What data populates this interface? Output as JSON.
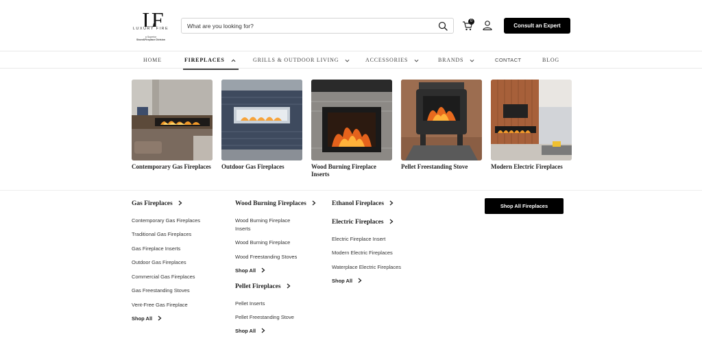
{
  "brand": {
    "logo_mark": "LF",
    "logo_name": "LUXURY FIRE",
    "logo_sub1": "a Superior",
    "logo_sub2": "Stove&Fireplace Division"
  },
  "search": {
    "placeholder": "What are you looking for?"
  },
  "cart": {
    "count": "0"
  },
  "header": {
    "consult_label": "Consult an Expert"
  },
  "nav": {
    "home": "HOME",
    "fireplaces": "FIREPLACES",
    "grills": "GRILLS & OUTDOOR LIVING",
    "accessories": "ACCESSORIES",
    "brands": "BRANDS",
    "contact": "CONTACT",
    "blog": "BLOG"
  },
  "categories": [
    {
      "label": "Contemporary Gas Fireplaces"
    },
    {
      "label": "Outdoor Gas Fireplaces"
    },
    {
      "label": "Wood Burning Fireplace Inserts"
    },
    {
      "label": "Pellet Freestanding Stove"
    },
    {
      "label": "Modern Electric Fireplaces"
    }
  ],
  "gas": {
    "heading": "Gas Fireplaces",
    "links": [
      "Contemporary Gas Fireplaces",
      "Traditional Gas Fireplaces",
      "Gas Fireplace Inserts",
      "Outdoor Gas Fireplaces",
      "Commercial Gas Fireplaces",
      "Gas Freestanding Stoves",
      "Vent-Free Gas Fireplace"
    ],
    "shop_all": "Shop All"
  },
  "wood": {
    "heading": "Wood Burning Fireplaces",
    "links": [
      "Wood Burning Fireplace Inserts",
      "Wood Burning Fireplace",
      "Wood Freestanding Stoves"
    ],
    "shop_all": "Shop All"
  },
  "pellet": {
    "heading": "Pellet Fireplaces",
    "links": [
      "Pellet Inserts",
      "Pellet Freestanding Stove"
    ],
    "shop_all": "Shop All"
  },
  "ethanol": {
    "heading": "Ethanol Fireplaces"
  },
  "electric": {
    "heading": "Electric Fireplaces",
    "links": [
      "Electric Fireplace Insert",
      "Modern Electric Fireplaces",
      "Waterplace Electric Fireplaces"
    ],
    "shop_all": "Shop All"
  },
  "shop_all_button": "Shop All Fireplaces"
}
